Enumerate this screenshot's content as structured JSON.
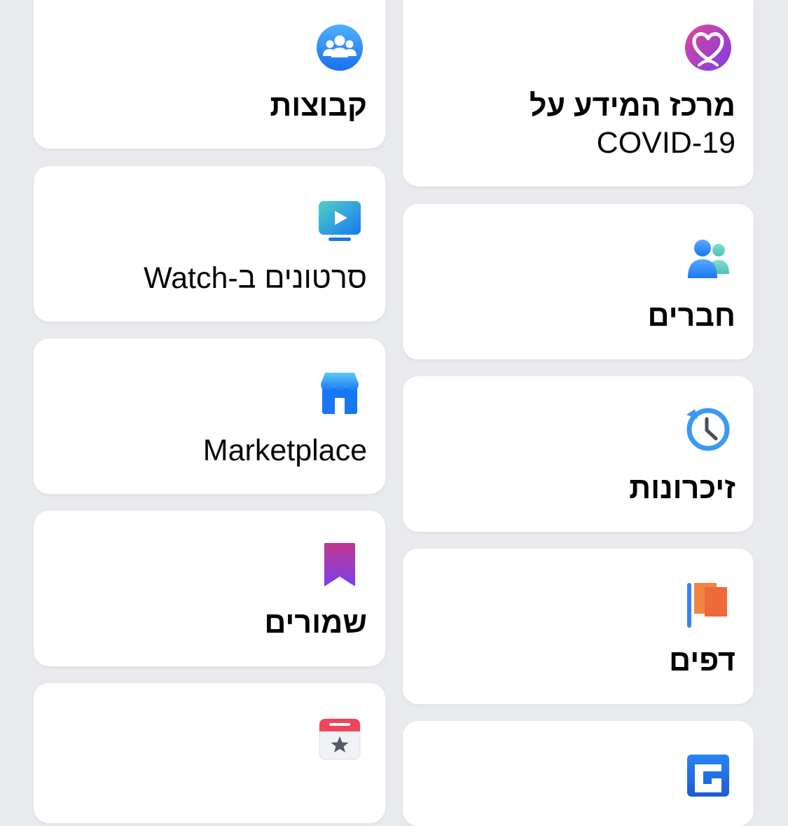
{
  "shortcuts": {
    "left": [
      {
        "label": "קבוצות",
        "icon": "groups-icon"
      },
      {
        "label": "סרטונים ב-Watch",
        "icon": "watch-video-icon"
      },
      {
        "label": "Marketplace",
        "icon": "marketplace-store-icon"
      },
      {
        "label": "שמורים",
        "icon": "saved-bookmark-icon"
      },
      {
        "label": "",
        "icon": "events-calendar-icon"
      }
    ],
    "right": [
      {
        "label_line1": "מרכז המידע על",
        "label_line2": "COVID-19",
        "icon": "covid-heart-icon"
      },
      {
        "label": "חברים",
        "icon": "friends-icon"
      },
      {
        "label": "זיכרונות",
        "icon": "memories-clock-icon"
      },
      {
        "label": "דפים",
        "icon": "pages-flag-icon"
      },
      {
        "label": "",
        "icon": "gaming-icon"
      }
    ]
  },
  "colors": {
    "background": "#e9eaee",
    "card": "#ffffff",
    "text": "#050505",
    "facebook_blue": "#1877f2"
  }
}
